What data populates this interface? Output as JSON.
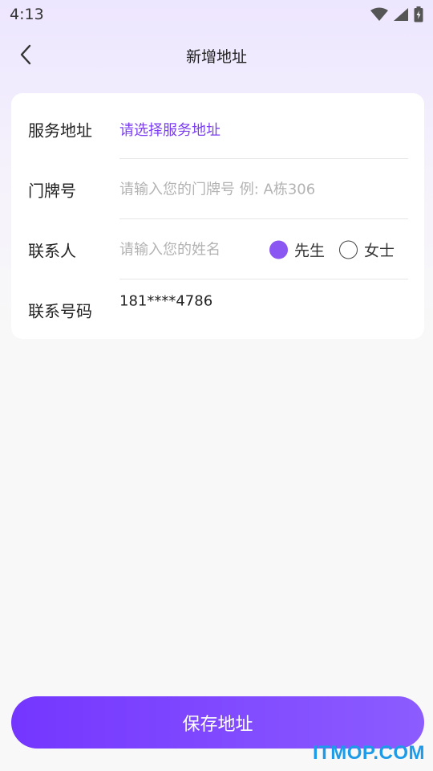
{
  "status_bar": {
    "time": "4:13",
    "icons": [
      "wifi-icon",
      "cell-signal-icon",
      "battery-icon"
    ]
  },
  "nav": {
    "back_icon": "chevron-left-icon",
    "title": "新增地址"
  },
  "form": {
    "service_address": {
      "label": "服务地址",
      "value": "请选择服务地址"
    },
    "door_number": {
      "label": "门牌号",
      "placeholder": "请输入您的门牌号 例: A栋306",
      "value": ""
    },
    "contact": {
      "label": "联系人",
      "placeholder": "请输入您的姓名",
      "value": "",
      "gender_options": [
        {
          "label": "先生",
          "checked": true
        },
        {
          "label": "女士",
          "checked": false
        }
      ]
    },
    "phone": {
      "label": "联系号码",
      "value": "181****4786"
    }
  },
  "save_button": {
    "label": "保存地址"
  },
  "watermark": "ITMOP.COM",
  "colors": {
    "accent": "#7b3ef0",
    "button_start": "#7436ff",
    "button_end": "#8c5cff",
    "radio_checked": "#8a57f2",
    "watermark": "#1e9be8"
  }
}
